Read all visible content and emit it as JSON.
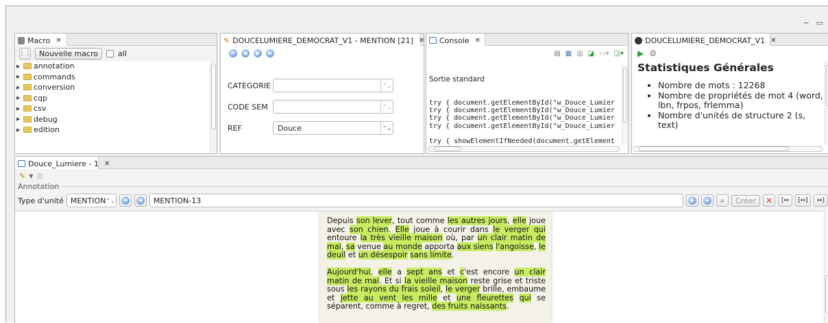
{
  "colors": {
    "highlight": "#c7ec62",
    "document_bg": "#f4f1e6",
    "folder": "#e8c75b",
    "nav_button": "#4a82d4",
    "delete_red": "#d93b2b"
  },
  "window_controls": {
    "minimize": "−",
    "maximize": "▭"
  },
  "macro_panel": {
    "tab_title": "Macro",
    "new_macro_label": "Nouvelle macro",
    "all_label": "all",
    "tree_items": [
      "annotation",
      "commands",
      "conversion",
      "cqp",
      "csv",
      "debug",
      "edition"
    ]
  },
  "mention_panel": {
    "tab_title": "DOUCELUMIERE_DEMOCRAT_V1 - MENTION [21]",
    "fields": [
      {
        "label": "CATEGORIE",
        "value": ""
      },
      {
        "label": "CODE SEM",
        "value": ""
      },
      {
        "label": "REF",
        "value": "Douce"
      }
    ]
  },
  "console_panel": {
    "tab_title": "Console",
    "header": "Sortie standard",
    "lines": [
      "try { document.getElementById(\"w_Douce_Lumier",
      "try { document.getElementById(\"w_Douce_Lumier",
      "try { document.getElementById(\"w_Douce_Lumier",
      "try { document.getElementById(\"w_Douce_Lumier",
      "",
      "try { showElementIfNeeded(document.getElement"
    ]
  },
  "stats_panel": {
    "tab_title": "DOUCELUMIERE_DEMOCRAT_V1",
    "title": "Statistiques Générales",
    "items": [
      "Nombre de mots : 12268",
      "Nombre de propriétés de mot 4 (word, lbn, frpos, frlemma)",
      "Nombre d'unités de structure 2 (s, text)"
    ]
  },
  "editor": {
    "tab_title": "Douce_Lumiere - 1",
    "annotation_label": "Annotation",
    "unit_type_label": "Type d'unité",
    "unit_type_value": "MENTION",
    "unit_id": "MENTION-13",
    "create_label": "Créer"
  },
  "document": {
    "paragraphs": [
      [
        {
          "t": "Depuis ",
          "h": false
        },
        {
          "t": "son lever",
          "h": true
        },
        {
          "t": ", tout comme ",
          "h": false
        },
        {
          "t": "les autres jours",
          "h": true
        },
        {
          "t": ", ",
          "h": false
        },
        {
          "t": "elle",
          "h": true
        },
        {
          "t": " joue avec ",
          "h": false
        },
        {
          "t": "son chien",
          "h": true
        },
        {
          "t": ". ",
          "h": false
        },
        {
          "t": "Elle",
          "h": true
        },
        {
          "t": " joue à courir dans ",
          "h": false
        },
        {
          "t": "le verger qui",
          "h": true
        },
        {
          "t": " entoure ",
          "h": false
        },
        {
          "t": "la très vieille maison",
          "h": true
        },
        {
          "t": " où, par ",
          "h": false
        },
        {
          "t": "un clair matin de mai",
          "h": true
        },
        {
          "t": ", ",
          "h": false
        },
        {
          "t": "sa",
          "h": true
        },
        {
          "t": " venue ",
          "h": false
        },
        {
          "t": "au monde",
          "h": true
        },
        {
          "t": " apporta ",
          "h": false
        },
        {
          "t": "aux siens",
          "h": true
        },
        {
          "t": " ",
          "h": false
        },
        {
          "t": "l'angoisse",
          "h": true
        },
        {
          "t": ", ",
          "h": false
        },
        {
          "t": "le deuil",
          "h": true
        },
        {
          "t": " et ",
          "h": false
        },
        {
          "t": "un désespoir",
          "h": true
        },
        {
          "t": " ",
          "h": false
        },
        {
          "t": "sans limite",
          "h": true
        },
        {
          "t": ".",
          "h": false
        }
      ],
      [
        {
          "t": "Aujourd'hui",
          "h": true
        },
        {
          "t": ", ",
          "h": false
        },
        {
          "t": "elle",
          "h": true
        },
        {
          "t": " a ",
          "h": false
        },
        {
          "t": "sept ans",
          "h": true
        },
        {
          "t": " et ",
          "h": false
        },
        {
          "t": "c",
          "h": true
        },
        {
          "t": "'est encore ",
          "h": false
        },
        {
          "t": "un clair matin de mai",
          "h": true
        },
        {
          "t": ". Et si ",
          "h": false
        },
        {
          "t": "la vieille maison",
          "h": true
        },
        {
          "t": " reste grise et triste sous ",
          "h": false
        },
        {
          "t": "les rayons du frais soleil",
          "h": true
        },
        {
          "t": ", ",
          "h": false
        },
        {
          "t": "le verger",
          "h": true
        },
        {
          "t": " brille, embaume et ",
          "h": false
        },
        {
          "t": "jette au vent les mille",
          "h": true
        },
        {
          "t": " et ",
          "h": false
        },
        {
          "t": "une fleurettes",
          "h": true
        },
        {
          "t": " ",
          "h": false
        },
        {
          "t": "qui",
          "h": true
        },
        {
          "t": " se séparent, comme à regret, ",
          "h": false
        },
        {
          "t": "des fruits naissants",
          "h": true
        },
        {
          "t": ".",
          "h": false
        }
      ]
    ]
  }
}
